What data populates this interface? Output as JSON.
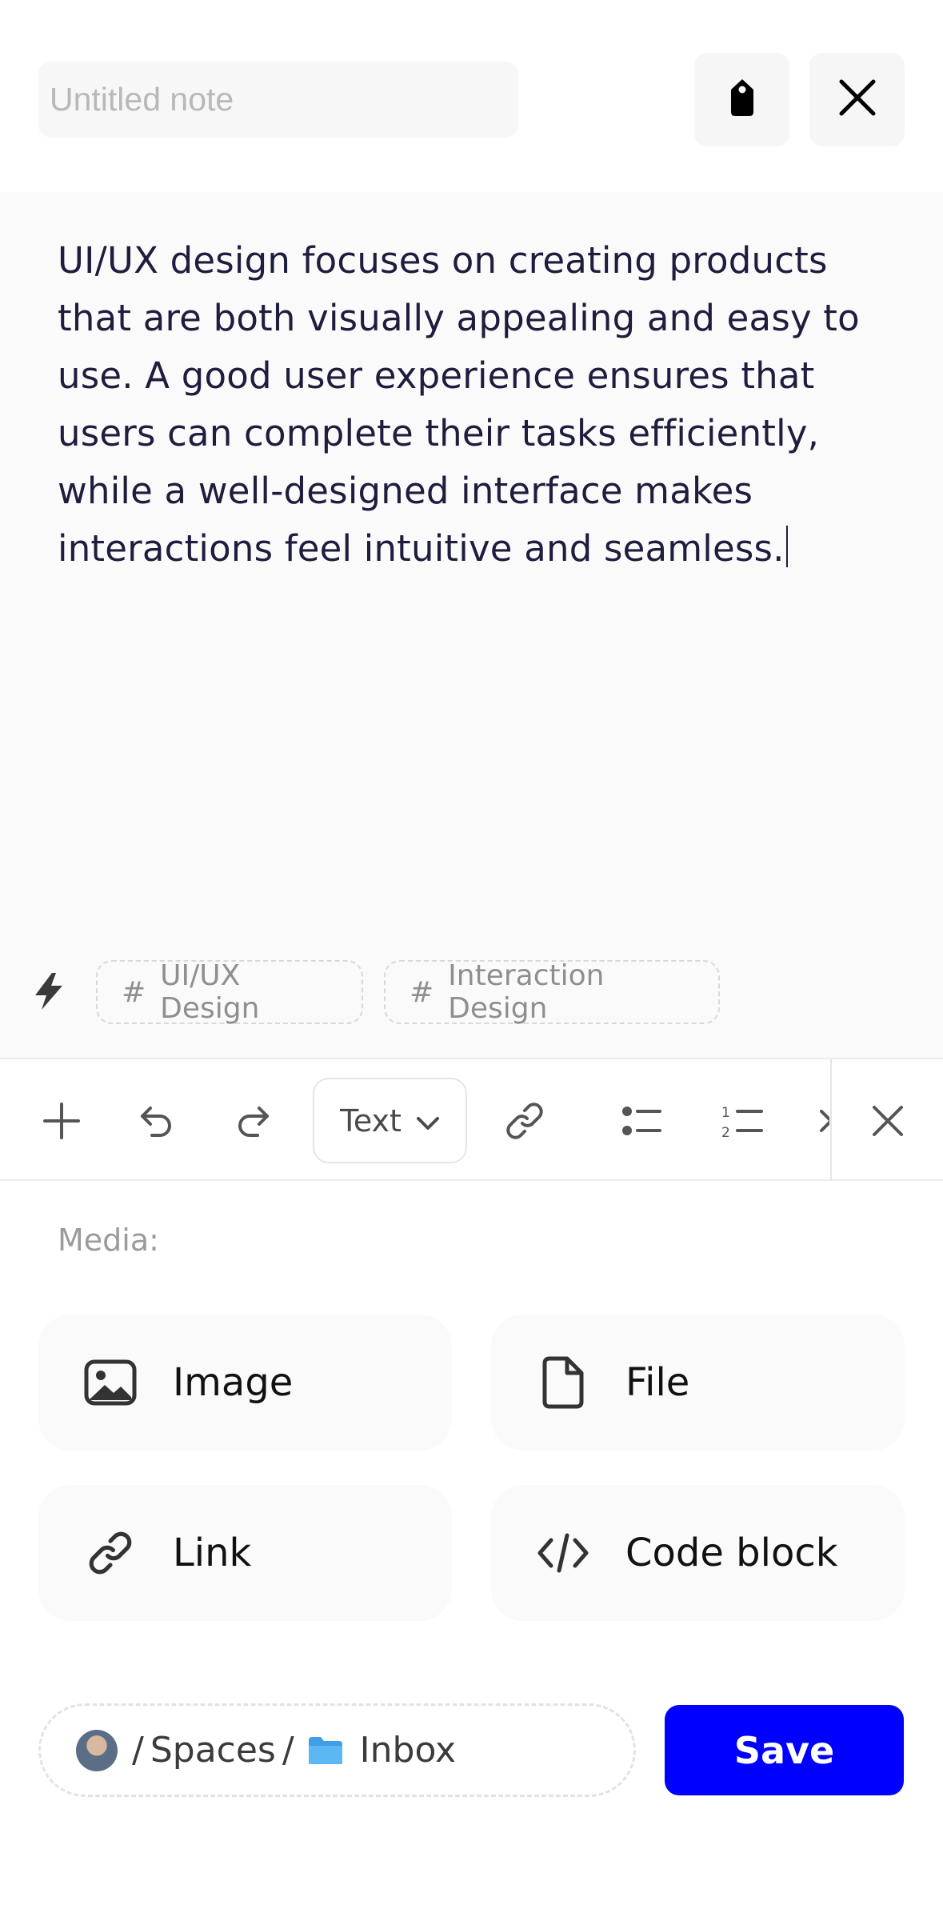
{
  "header": {
    "title_placeholder": "Untitled note",
    "tag_icon": "tag-icon",
    "close_icon": "close-icon"
  },
  "editor": {
    "body_text": "UI/UX design focuses on creating products that are both visually appealing and easy to use. A good user experience ensures that users can complete their tasks efficiently, while a well-designed interface makes interactions feel intuitive and seamless."
  },
  "tags": {
    "icon": "bolt-icon",
    "items": [
      {
        "hash": "#",
        "label": "UI/UX Design"
      },
      {
        "hash": "#",
        "label": "Interaction Design"
      }
    ]
  },
  "toolbar": {
    "text_style": "Text",
    "icons": [
      "plus-icon",
      "undo-icon",
      "redo-icon",
      "chevron-down-icon",
      "link-icon",
      "bullet-list-icon",
      "numbered-list-icon",
      "close-icon"
    ]
  },
  "media": {
    "label": "Media:",
    "items": [
      {
        "label": "Image",
        "icon": "image-icon"
      },
      {
        "label": "File",
        "icon": "file-icon"
      },
      {
        "label": "Link",
        "icon": "link-icon"
      },
      {
        "label": "Code block",
        "icon": "code-icon"
      }
    ]
  },
  "footer": {
    "separator": "/",
    "space_label": "Spaces",
    "folder_label": "Inbox",
    "save_label": "Save"
  },
  "colors": {
    "accent": "#0000ff",
    "text": "#1f1d3d",
    "muted": "#9b9b9b"
  }
}
